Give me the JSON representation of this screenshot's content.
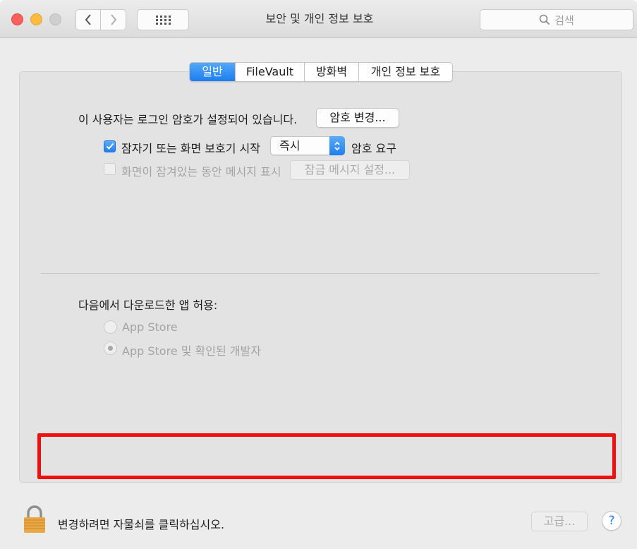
{
  "window": {
    "title": "보안 및 개인 정보 보호",
    "search_placeholder": "검색"
  },
  "tabs": [
    {
      "label": "일반",
      "active": true
    },
    {
      "label": "FileVault",
      "active": false
    },
    {
      "label": "방화벽",
      "active": false
    },
    {
      "label": "개인 정보 보호",
      "active": false
    }
  ],
  "general": {
    "password_text": "이 사용자는 로그인 암호가 설정되어 있습니다.",
    "change_password_button": "암호 변경...",
    "require_password": {
      "label": "잠자기 또는 화면 보호기 시작",
      "checked": true,
      "delay_value": "즉시",
      "suffix": "암호 요구"
    },
    "lock_message": {
      "label": "화면이 잠겨있는 동안 메시지 표시",
      "checked": false,
      "button": "잠금 메시지 설정..."
    }
  },
  "downloads": {
    "heading": "다음에서 다운로드한 앱 허용:",
    "options": [
      {
        "label": "App Store",
        "selected": false
      },
      {
        "label": "App Store 및 확인된 개발자",
        "selected": true
      }
    ]
  },
  "footer": {
    "lock_text": "변경하려면 자물쇠를 클릭하십시오.",
    "advanced_button": "고급...",
    "help_button": "?"
  },
  "colors": {
    "accent": "#1f7ff2",
    "highlight_box": "#f01010"
  }
}
